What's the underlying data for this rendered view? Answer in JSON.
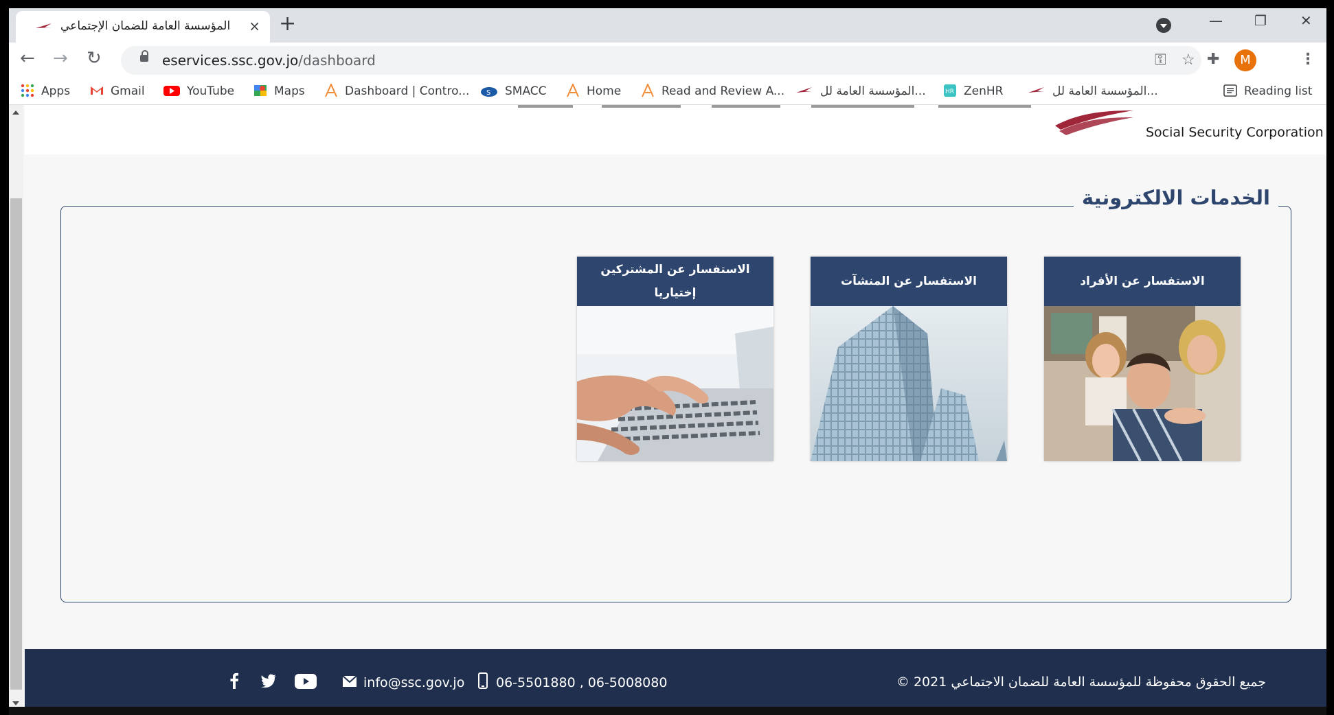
{
  "browser": {
    "tab": {
      "title": "المؤسسة العامة للضمان الإجتماعي",
      "close": "×"
    },
    "new_tab": "+",
    "window_controls": {
      "minimize": "—",
      "restore": "❐",
      "close": "✕"
    },
    "url": {
      "host": "eservices.ssc.gov.jo",
      "path": "/dashboard"
    },
    "profile_initial": "M",
    "bookmarks": [
      {
        "label": "Apps",
        "icon": "apps-grid-icon"
      },
      {
        "label": "Gmail",
        "icon": "gmail-icon"
      },
      {
        "label": "YouTube",
        "icon": "youtube-icon"
      },
      {
        "label": "Maps",
        "icon": "maps-icon"
      },
      {
        "label": "Dashboard | Contro...",
        "icon": "a-logo-icon"
      },
      {
        "label": "SMACC",
        "icon": "smacc-icon"
      },
      {
        "label": "Home",
        "icon": "a-logo-icon"
      },
      {
        "label": "Read and Review A...",
        "icon": "a-logo-icon"
      },
      {
        "label": "المؤسسة العامة لل...",
        "icon": "ssc-logo-icon"
      },
      {
        "label": "ZenHR",
        "icon": "zenhr-icon"
      },
      {
        "label": "المؤسسة العامة لل...",
        "icon": "ssc-logo-icon"
      }
    ],
    "reading_list": "Reading list"
  },
  "site": {
    "logo_text": "Social Security Corporation",
    "section_title": "الخدمات الالكترونية",
    "cards": [
      {
        "title": "الاستفسار عن الأفراد",
        "image": "family-photo"
      },
      {
        "title": "الاستفسار عن المنشآت",
        "image": "building-photo"
      },
      {
        "title": "الاستفسار عن المشتركين إختياريا",
        "image": "laptop-typing-photo"
      }
    ],
    "footer": {
      "copyright": "جميع الحقوق محفوظة للمؤسسة العامة للضمان الاجتماعي 2021 ©",
      "phones": "06-5501880 , 06-5008080",
      "email": "info@ssc.gov.jo",
      "social": [
        "facebook-icon",
        "twitter-icon",
        "youtube-icon"
      ]
    }
  },
  "colors": {
    "brand_navy": "#2e456d",
    "footer_bg": "#1f2f4d",
    "brand_red": "#a0263a",
    "profile": "#e8710a"
  }
}
